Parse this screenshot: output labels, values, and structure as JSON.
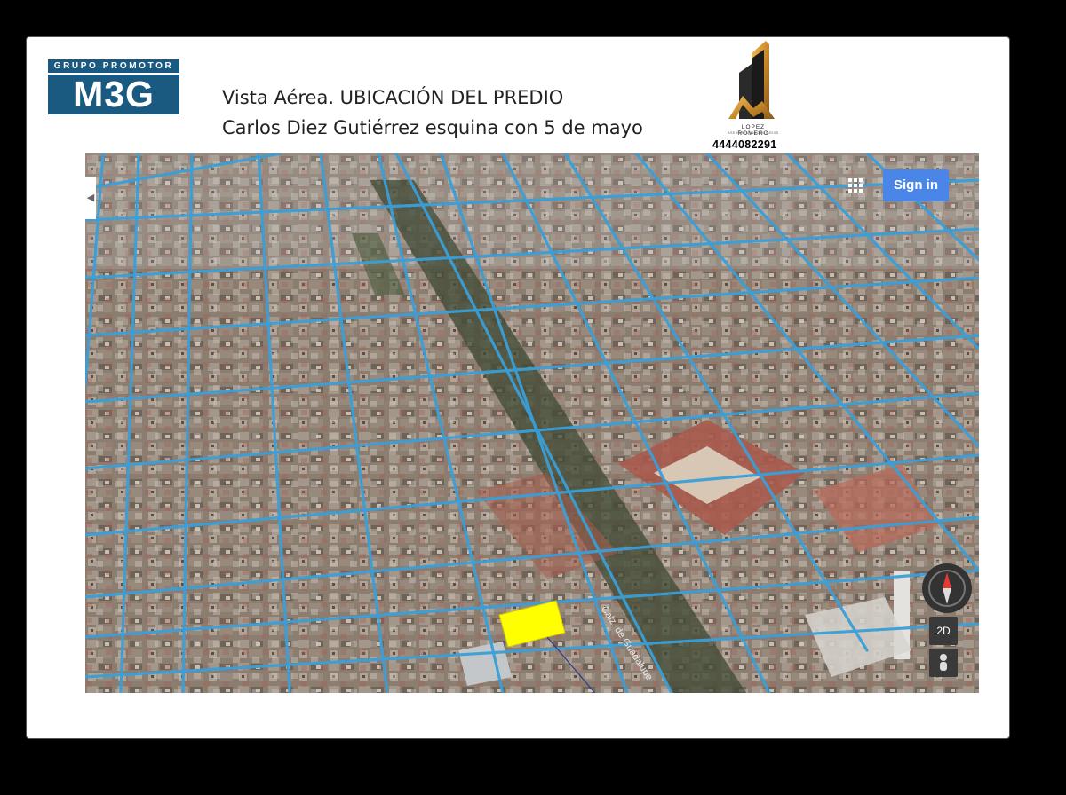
{
  "logo_m3g": {
    "tagline": "GRUPO PROMOTOR",
    "name": "M3G"
  },
  "title": {
    "line1": "Vista Aérea.  UBICACIÓN DEL PREDIO",
    "line2": "Carlos Diez Gutiérrez esquina con 5 de mayo"
  },
  "logo_lopez_romero": {
    "name": "LOPEZ ROMERO",
    "subtitle": "ASESORES INMOBILIARIOS",
    "phone": "4444082291"
  },
  "map": {
    "signin_label": "Sign in",
    "mode_2d_label": "2D",
    "street_label": "Calz. de Guadalupe",
    "road_color": "#3a9fd8",
    "highlight_color": "#ffff00",
    "icons": [
      "apps-grid-icon",
      "compass-icon",
      "pegman-icon",
      "collapse-arrow-icon"
    ]
  }
}
